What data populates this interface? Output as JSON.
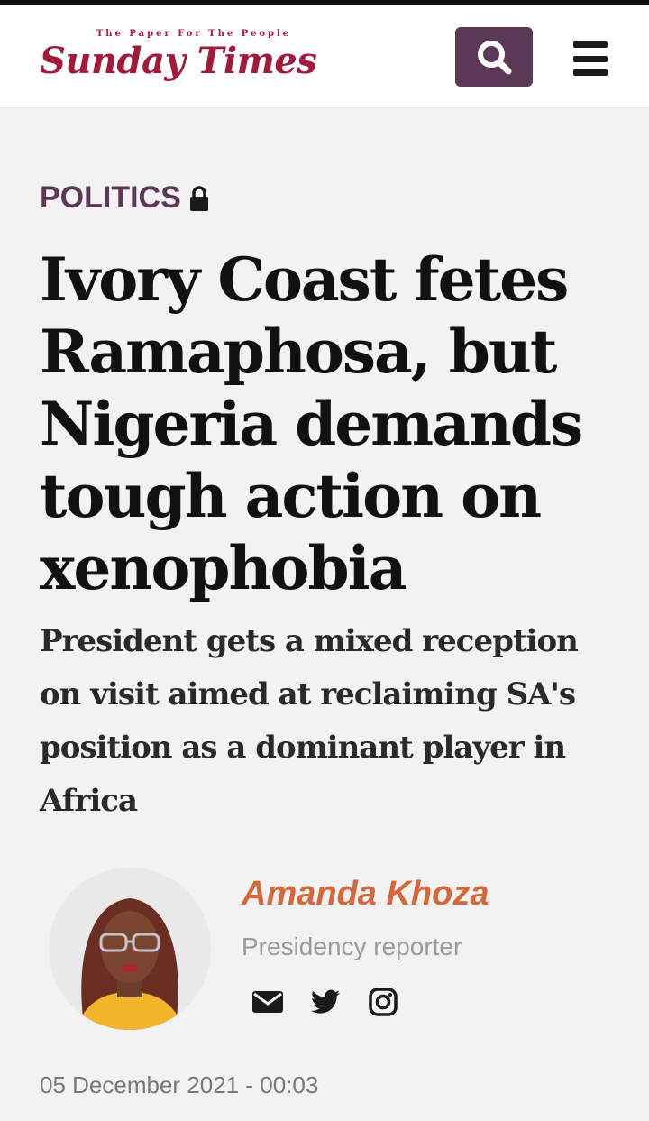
{
  "header": {
    "tagline": "The Paper For The People",
    "logo_text": "Sunday Times",
    "search_icon": "search-icon",
    "menu_icon": "hamburger-menu-icon",
    "brand_color": "#a3193a",
    "accent_color": "#5b3956"
  },
  "article": {
    "section": "POLITICS",
    "section_icon": "lock-icon",
    "headline": "Ivory Coast fetes Ramaphosa, but Nigeria demands tough action on xenophobia",
    "subheadline": "President gets a mixed reception on visit aimed at reclaiming SA's position as a dominant player in Africa",
    "author": {
      "name": "Amanda Khoza",
      "role": "Presidency reporter",
      "name_color": "#d4683a",
      "socials": [
        "envelope-icon",
        "twitter-icon",
        "instagram-icon"
      ]
    },
    "date": "05 December 2021 - 00:03"
  }
}
